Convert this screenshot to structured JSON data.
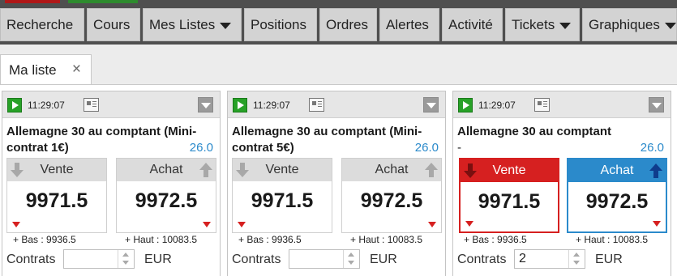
{
  "menu": {
    "items": [
      {
        "label": "Recherche",
        "dropdown": false
      },
      {
        "label": "Cours",
        "dropdown": false
      },
      {
        "label": "Mes Listes",
        "dropdown": true
      },
      {
        "label": "Positions",
        "dropdown": false
      },
      {
        "label": "Ordres",
        "dropdown": false
      },
      {
        "label": "Alertes",
        "dropdown": false
      },
      {
        "label": "Activité",
        "dropdown": false
      },
      {
        "label": "Tickets",
        "dropdown": true
      },
      {
        "label": "Graphiques",
        "dropdown": true
      }
    ]
  },
  "tab": {
    "label": "Ma liste",
    "close": "×"
  },
  "panels": [
    {
      "time": "11:29:07",
      "title_line1": "Allemagne 30 au comptant (Mini-",
      "title_line2": "contrat 1€)",
      "value": "26.0",
      "sell": {
        "label": "Vente",
        "price": "9971.5"
      },
      "buy": {
        "label": "Achat",
        "price": "9972.5"
      },
      "low": "+ Bas : 9936.5",
      "high": "+ Haut : 10083.5",
      "contracts_label": "Contrats",
      "quantity": "",
      "currency": "EUR"
    },
    {
      "time": "11:29:07",
      "title_line1": "Allemagne 30 au comptant (Mini-",
      "title_line2": "contrat 5€)",
      "value": "26.0",
      "sell": {
        "label": "Vente",
        "price": "9971.5"
      },
      "buy": {
        "label": "Achat",
        "price": "9972.5"
      },
      "low": "+ Bas : 9936.5",
      "high": "+ Haut : 10083.5",
      "contracts_label": "Contrats",
      "quantity": "",
      "currency": "EUR"
    },
    {
      "time": "11:29:07",
      "title_line1": "Allemagne 30 au comptant",
      "title_line2": "-",
      "value": "26.0",
      "sell": {
        "label": "Vente",
        "price": "9971.5"
      },
      "buy": {
        "label": "Achat",
        "price": "9972.5"
      },
      "low": "+ Bas : 9936.5",
      "high": "+ Haut : 10083.5",
      "contracts_label": "Contrats",
      "quantity": "2",
      "currency": "EUR"
    }
  ],
  "colors": {
    "sell_active": "#d62020",
    "buy_active": "#2b8acb",
    "change_value": "#2b8acb",
    "play_green": "#27a127"
  }
}
